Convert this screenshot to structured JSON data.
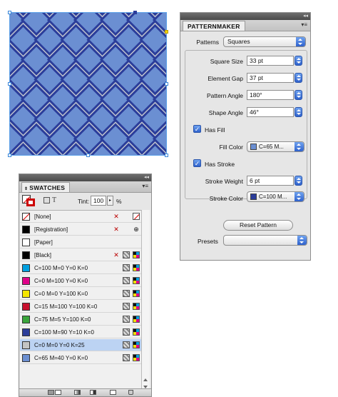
{
  "patternmaker": {
    "panel_title": "PATTERNMAKER",
    "patterns_label": "Patterns",
    "patterns_value": "Squares",
    "square_size_label": "Square Size",
    "square_size_value": "33 pt",
    "element_gap_label": "Element Gap",
    "element_gap_value": "37 pt",
    "pattern_angle_label": "Pattern Angle",
    "pattern_angle_value": "180°",
    "shape_angle_label": "Shape Angle",
    "shape_angle_value": "46°",
    "has_fill_label": "Has Fill",
    "has_fill_checked": true,
    "fill_color_label": "Fill Color",
    "fill_color_value": "C=65 M...",
    "fill_color_hex": "#6b8fd2",
    "has_stroke_label": "Has Stroke",
    "has_stroke_checked": true,
    "stroke_weight_label": "Stroke Weight",
    "stroke_weight_value": "6 pt",
    "stroke_color_label": "Stroke Color",
    "stroke_color_value": "C=100 M...",
    "stroke_color_hex": "#2b3d9a",
    "reset_button": "Reset Pattern",
    "presets_label": "Presets",
    "presets_value": ""
  },
  "swatches": {
    "panel_title": "SWATCHES",
    "text_mode_glyph": "T",
    "tint_label": "Tint:",
    "tint_value": "100",
    "tint_unit": "%",
    "items": [
      {
        "name": "[None]",
        "color": "none",
        "icons": [
          "noedit",
          "none"
        ]
      },
      {
        "name": "[Registration]",
        "color": "#000000",
        "icons": [
          "noedit",
          "reg"
        ]
      },
      {
        "name": "[Paper]",
        "color": "#ffffff",
        "icons": []
      },
      {
        "name": "[Black]",
        "color": "#000000",
        "icons": [
          "noedit",
          "proc",
          "cmyk"
        ]
      },
      {
        "name": "C=100 M=0 Y=0 K=0",
        "color": "#00a0e0",
        "icons": [
          "proc",
          "cmyk"
        ]
      },
      {
        "name": "C=0 M=100 Y=0 K=0",
        "color": "#e0008a",
        "icons": [
          "proc",
          "cmyk"
        ]
      },
      {
        "name": "C=0 M=0 Y=100 K=0",
        "color": "#f5e600",
        "icons": [
          "proc",
          "cmyk"
        ]
      },
      {
        "name": "C=15 M=100 Y=100 K=0",
        "color": "#c8102e",
        "icons": [
          "proc",
          "cmyk"
        ]
      },
      {
        "name": "C=75 M=5 Y=100 K=0",
        "color": "#3aa53c",
        "icons": [
          "proc",
          "cmyk"
        ]
      },
      {
        "name": "C=100 M=90 Y=10 K=0",
        "color": "#2b3d9a",
        "icons": [
          "proc",
          "cmyk"
        ]
      },
      {
        "name": "C=0 M=0 Y=0 K=25",
        "color": "#c4c4c4",
        "icons": [
          "proc",
          "cmyk"
        ],
        "selected": true
      },
      {
        "name": "C=65 M=40 Y=0 K=0",
        "color": "#6b8fd2",
        "icons": [
          "proc",
          "cmyk"
        ]
      }
    ]
  },
  "artwork": {
    "background_hex": "#c4c7cf",
    "fill_hex": "#6b8fd2",
    "stroke_hex": "#2b3d9a"
  }
}
